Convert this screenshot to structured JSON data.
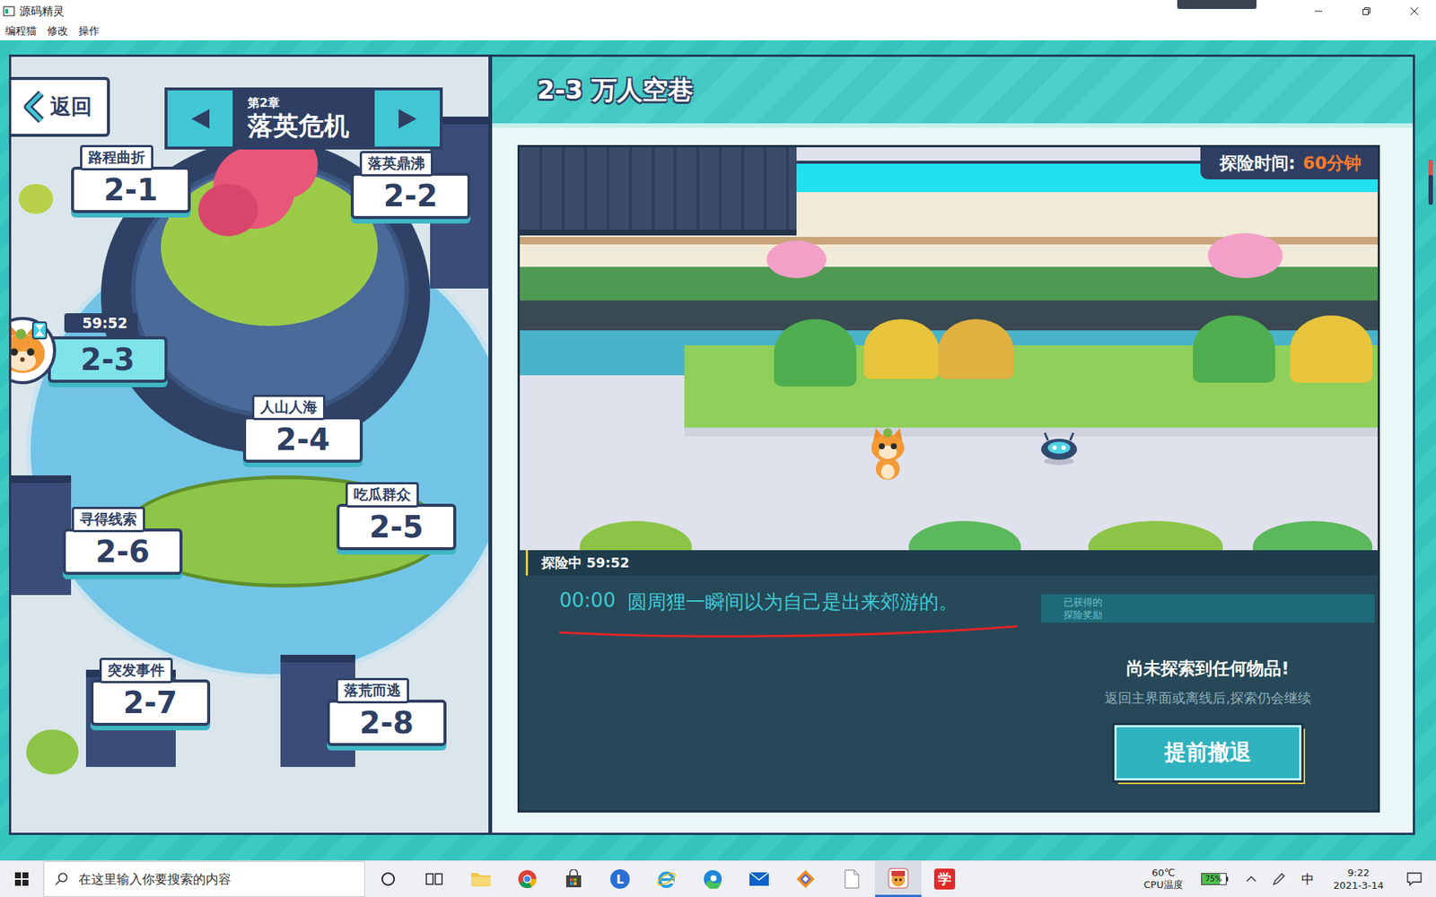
{
  "window": {
    "title": "源码精灵"
  },
  "menu": [
    {
      "label": "编程猫"
    },
    {
      "label": "修改"
    },
    {
      "label": "操作"
    }
  ],
  "map": {
    "back_label": "返回",
    "chapter": {
      "number": "第2章",
      "name": "落英危机"
    },
    "levels": [
      {
        "code": "2-1",
        "name": "路程曲折",
        "kind": "named",
        "selected": false
      },
      {
        "code": "2-2",
        "name": "落英鼎沸",
        "kind": "named",
        "selected": false
      },
      {
        "code": "2-3",
        "timer": "59:52",
        "kind": "exploring",
        "selected": true
      },
      {
        "code": "2-4",
        "name": "人山人海",
        "kind": "named",
        "selected": false
      },
      {
        "code": "2-5",
        "name": "吃瓜群众",
        "kind": "named",
        "selected": false
      },
      {
        "code": "2-6",
        "name": "寻得线索",
        "kind": "named",
        "selected": false
      },
      {
        "code": "2-7",
        "name": "突发事件",
        "kind": "named",
        "selected": false
      },
      {
        "code": "2-8",
        "name": "落荒而逃",
        "kind": "named",
        "selected": false
      }
    ]
  },
  "detail": {
    "title": "2-3 万人空巷",
    "time_label": "探险时间:",
    "time_value": "60分钟",
    "status": "探险中 59:52",
    "log": [
      {
        "time": "00:00",
        "text": "圆周狸一瞬间以为自己是出来郊游的。"
      }
    ],
    "reward_label": [
      "已获得的",
      "探险奖励"
    ],
    "empty_title": "尚未探索到任何物品!",
    "empty_hint": "返回主界面或离线后,探索仍会继续",
    "button": "提前撤退"
  },
  "taskbar": {
    "search_placeholder": "在这里输入你要搜索的内容",
    "apps": [
      {
        "kind": "explorer",
        "active": false
      },
      {
        "kind": "chrome",
        "active": false
      },
      {
        "kind": "store",
        "active": false
      },
      {
        "kind": "letter",
        "label": "L",
        "active": false
      },
      {
        "kind": "ie",
        "active": false
      },
      {
        "kind": "edge",
        "active": false
      },
      {
        "kind": "mail",
        "active": false
      },
      {
        "kind": "orange",
        "active": false
      },
      {
        "kind": "file",
        "active": false
      },
      {
        "kind": "codemao",
        "active": true
      },
      {
        "kind": "xue",
        "label": "学",
        "active": false
      }
    ],
    "cpu": {
      "temp": "60℃",
      "label": "CPU温度"
    },
    "battery": {
      "reading": "75%",
      "level": 0.75
    },
    "ime": "中",
    "time": "9:22",
    "date": "2021-3-14"
  }
}
